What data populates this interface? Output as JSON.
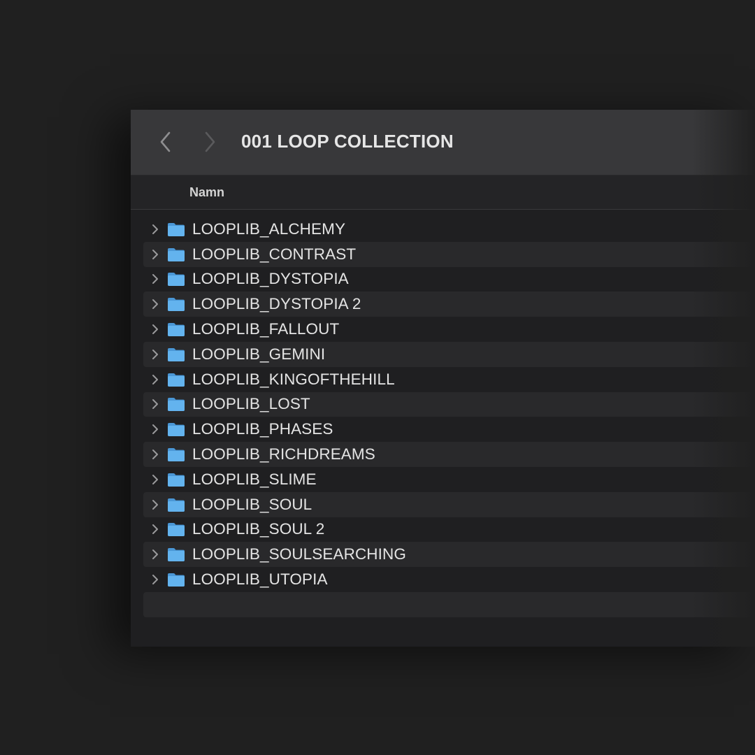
{
  "window": {
    "title": "001 LOOP COLLECTION"
  },
  "toolbar": {
    "back_icon": "chevron-left-icon",
    "forward_icon": "chevron-right-icon"
  },
  "columns": {
    "name": "Namn"
  },
  "folders": [
    {
      "name": "LOOPLIB_ALCHEMY"
    },
    {
      "name": "LOOPLIB_CONTRAST"
    },
    {
      "name": "LOOPLIB_DYSTOPIA"
    },
    {
      "name": "LOOPLIB_DYSTOPIA 2"
    },
    {
      "name": "LOOPLIB_FALLOUT"
    },
    {
      "name": "LOOPLIB_GEMINI"
    },
    {
      "name": "LOOPLIB_KINGOFTHEHILL"
    },
    {
      "name": "LOOPLIB_LOST"
    },
    {
      "name": "LOOPLIB_PHASES"
    },
    {
      "name": "LOOPLIB_RICHDREAMS"
    },
    {
      "name": "LOOPLIB_SLIME"
    },
    {
      "name": "LOOPLIB_SOUL"
    },
    {
      "name": "LOOPLIB_SOUL 2"
    },
    {
      "name": "LOOPLIB_SOULSEARCHING"
    },
    {
      "name": "LOOPLIB_UTOPIA"
    }
  ],
  "colors": {
    "background": "#202020",
    "toolbar": "#38383a",
    "row_alt": "#29292b",
    "folder_blue": "#5aa9e6",
    "text": "#e4e4e4"
  }
}
